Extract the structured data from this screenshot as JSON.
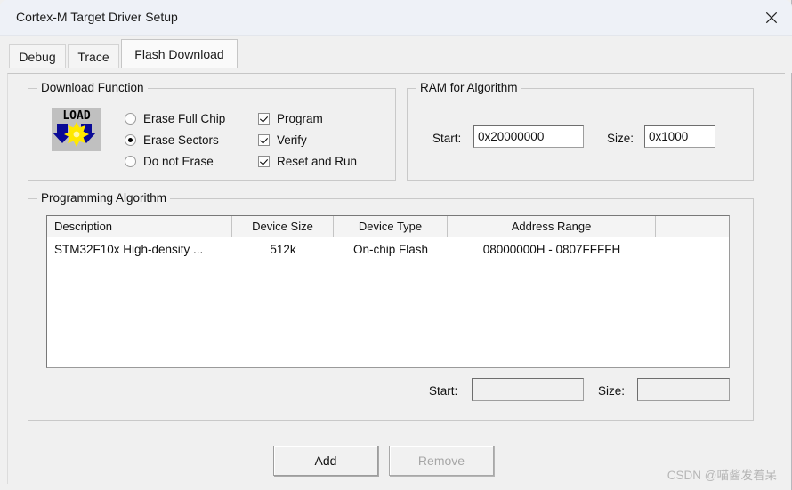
{
  "window": {
    "title": "Cortex-M Target Driver Setup",
    "close_icon": "close-icon"
  },
  "tabs": [
    {
      "id": "debug",
      "label": "Debug",
      "active": false
    },
    {
      "id": "trace",
      "label": "Trace",
      "active": false
    },
    {
      "id": "flash",
      "label": "Flash Download",
      "active": true
    }
  ],
  "download_function": {
    "title": "Download Function",
    "icon": "load-icon",
    "icon_text": "LOAD",
    "radios": [
      {
        "label": "Erase Full Chip",
        "selected": false
      },
      {
        "label": "Erase Sectors",
        "selected": true
      },
      {
        "label": "Do not Erase",
        "selected": false
      }
    ],
    "checkboxes": [
      {
        "label": "Program",
        "checked": true
      },
      {
        "label": "Verify",
        "checked": true
      },
      {
        "label": "Reset and Run",
        "checked": true
      }
    ]
  },
  "ram_for_algorithm": {
    "title": "RAM for Algorithm",
    "start_label": "Start:",
    "start_value": "0x20000000",
    "size_label": "Size:",
    "size_value": "0x1000"
  },
  "programming_algorithm": {
    "title": "Programming Algorithm",
    "columns": [
      "Description",
      "Device Size",
      "Device Type",
      "Address Range",
      ""
    ],
    "rows": [
      {
        "description": "STM32F10x High-density ...",
        "device_size": "512k",
        "device_type": "On-chip Flash",
        "address_range": "08000000H - 0807FFFFH",
        "extra": ""
      }
    ],
    "start_label": "Start:",
    "start_value": "",
    "size_label": "Size:",
    "size_value": ""
  },
  "buttons": {
    "add": {
      "label": "Add",
      "enabled": true
    },
    "remove": {
      "label": "Remove",
      "enabled": false
    }
  },
  "watermark": "CSDN @喵酱发着呆"
}
